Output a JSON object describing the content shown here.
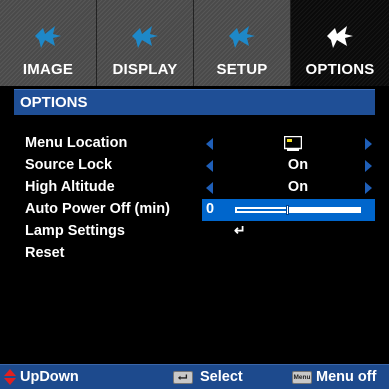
{
  "tabs": [
    {
      "label": "IMAGE",
      "icon": "image-icon",
      "active": false
    },
    {
      "label": "DISPLAY",
      "icon": "display-icon",
      "active": false
    },
    {
      "label": "SETUP",
      "icon": "setup-icon",
      "active": false
    },
    {
      "label": "OPTIONS",
      "icon": "options-icon",
      "active": true
    }
  ],
  "title": "OPTIONS",
  "rows": [
    {
      "label": "Menu Location",
      "value_icon": "menu-location-screen-icon"
    },
    {
      "label": "Source Lock",
      "value": "On"
    },
    {
      "label": "High Altitude",
      "value": "On"
    },
    {
      "label": "Auto Power Off (min)",
      "value": "0",
      "level_fraction": 0.0
    },
    {
      "label": "Lamp Settings",
      "value_icon": "enter-icon"
    },
    {
      "label": "Reset"
    }
  ],
  "footer": {
    "updown": "UpDown",
    "select": "Select",
    "menu_key": "Menu",
    "menu_off": "Menu off"
  },
  "colors": {
    "accent": "#0066cc",
    "title_bar": "#1f4f96",
    "footer": "#1d4a8d",
    "tab_inactive": "#4a4a4a",
    "tab_icon_inactive": "#1e88c8",
    "tab_icon_active": "#ffffff",
    "updown_icon": "#e02020"
  }
}
